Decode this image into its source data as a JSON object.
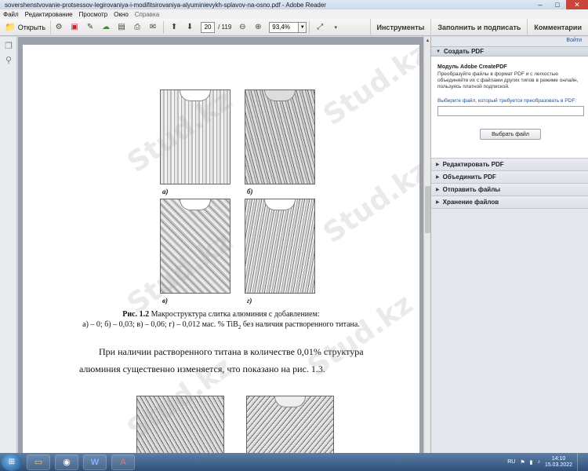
{
  "window": {
    "title": "sovershenstvovanie-protsessov-legirovaniya-i-modifitsirovaniya-alyuminievykh-splavov-na-osno.pdf - Adobe Reader",
    "minimize": "–",
    "maximize": "□",
    "close": "✕"
  },
  "menu": {
    "items": [
      "Файл",
      "Редактирование",
      "Просмотр",
      "Окно",
      "Справка"
    ]
  },
  "toolbar": {
    "open_label": "Открыть",
    "page_current": "20",
    "page_total": "/ 119",
    "zoom": "93,4%",
    "tools_label": "Инструменты",
    "fill_sign_label": "Заполнить и подписать",
    "comments_label": "Комментарии"
  },
  "document": {
    "fig_labels": [
      "а)",
      "б)",
      "в)",
      "г)"
    ],
    "caption_prefix": "Рис. 1.2",
    "caption_line1_rest": " Макроструктура слитка алюминия с добавлением:",
    "caption_line2": "а) – 0; б) – 0,03; в) – 0,06; г) – 0,012 мас. % TiB",
    "caption_sub": "2",
    "caption_line2_end": " без наличия растворенного титана.",
    "para_line1": "При наличии растворенного титана в количестве 0,01% структура",
    "para_line2": "алюминия существенно изменяется, что показано на рис. 1.3.",
    "watermark": "Stud.kz"
  },
  "right_panel": {
    "login": "Войти",
    "create_pdf": "Создать PDF",
    "module_title": "Модуль Adobe CreatePDF",
    "module_desc": "Преобразуйте файлы в формат PDF и с легкостью объединяйте их с файлами других типов в режиме онлайн, пользуясь платной подпиской.",
    "choose_file_label": "Выберите файл, который требуется преобразовать в PDF:",
    "choose_button": "Выбрать файл",
    "sections": [
      "Редактировать PDF",
      "Объединить PDF",
      "Отправить файлы",
      "Хранение файлов"
    ]
  },
  "taskbar": {
    "lang": "RU",
    "time": "14:10",
    "date": "15.03.2022"
  }
}
